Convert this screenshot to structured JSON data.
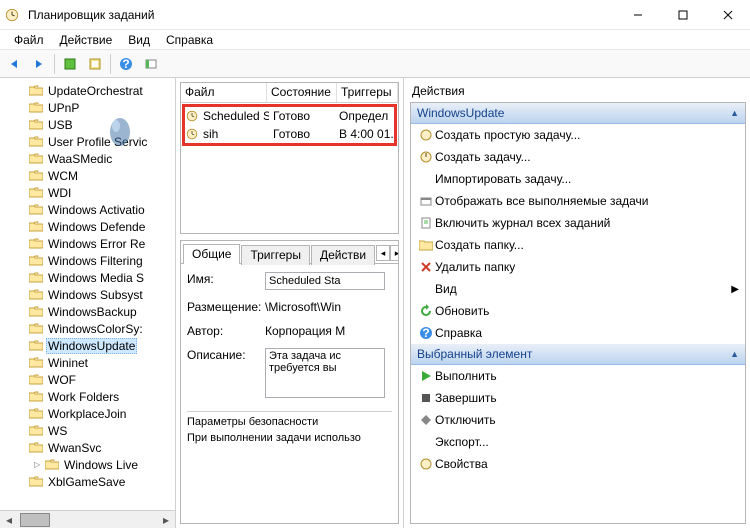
{
  "window": {
    "title": "Планировщик заданий"
  },
  "menu": {
    "file": "Файл",
    "action": "Действие",
    "view": "Вид",
    "help": "Справка"
  },
  "tree": {
    "items": [
      "UpdateOrchestrat",
      "UPnP",
      "USB",
      "User Profile Servic",
      "WaaSMedic",
      "WCM",
      "WDI",
      "Windows Activatio",
      "Windows Defende",
      "Windows Error Re",
      "Windows Filtering",
      "Windows Media S",
      "Windows Subsyst",
      "WindowsBackup",
      "WindowsColorSy:",
      "WindowsUpdate",
      "Wininet",
      "WOF",
      "Work Folders",
      "WorkplaceJoin",
      "WS",
      "WwanSvc",
      "Windows Live",
      "XblGameSave"
    ],
    "selected_index": 15,
    "nested_index": 22
  },
  "list": {
    "cols": {
      "file": "Файл",
      "state": "Состояние",
      "triggers": "Триггеры"
    },
    "rows": [
      {
        "file": "Scheduled S…",
        "state": "Готово",
        "trigger": "Определ"
      },
      {
        "file": "sih",
        "state": "Готово",
        "trigger": "В 4:00 01."
      }
    ]
  },
  "detail": {
    "tabs": {
      "general": "Общие",
      "triggers": "Триггеры",
      "actions": "Действи"
    },
    "name_label": "Имя:",
    "name_value": "Scheduled Sta",
    "loc_label": "Размещение:",
    "loc_value": "\\Microsoft\\Win",
    "author_label": "Автор:",
    "author_value": "Корпорация М",
    "desc_label": "Описание:",
    "desc_value": "Эта задача ис требуется вы",
    "sec_title": "Параметры безопасности",
    "sec_sub": "При выполнении задачи использо"
  },
  "actions": {
    "title": "Действия",
    "group1": "WindowsUpdate",
    "g1": {
      "createBasic": "Создать простую задачу...",
      "create": "Создать задачу...",
      "import": "Импортировать задачу...",
      "showAll": "Отображать все выполняемые задачи",
      "enableLog": "Включить журнал всех заданий",
      "newFolder": "Создать папку...",
      "deleteFolder": "Удалить папку",
      "view": "Вид",
      "refresh": "Обновить",
      "help": "Справка"
    },
    "group2": "Выбранный элемент",
    "g2": {
      "run": "Выполнить",
      "end": "Завершить",
      "disable": "Отключить",
      "export": "Экспорт...",
      "props": "Свойства"
    }
  }
}
